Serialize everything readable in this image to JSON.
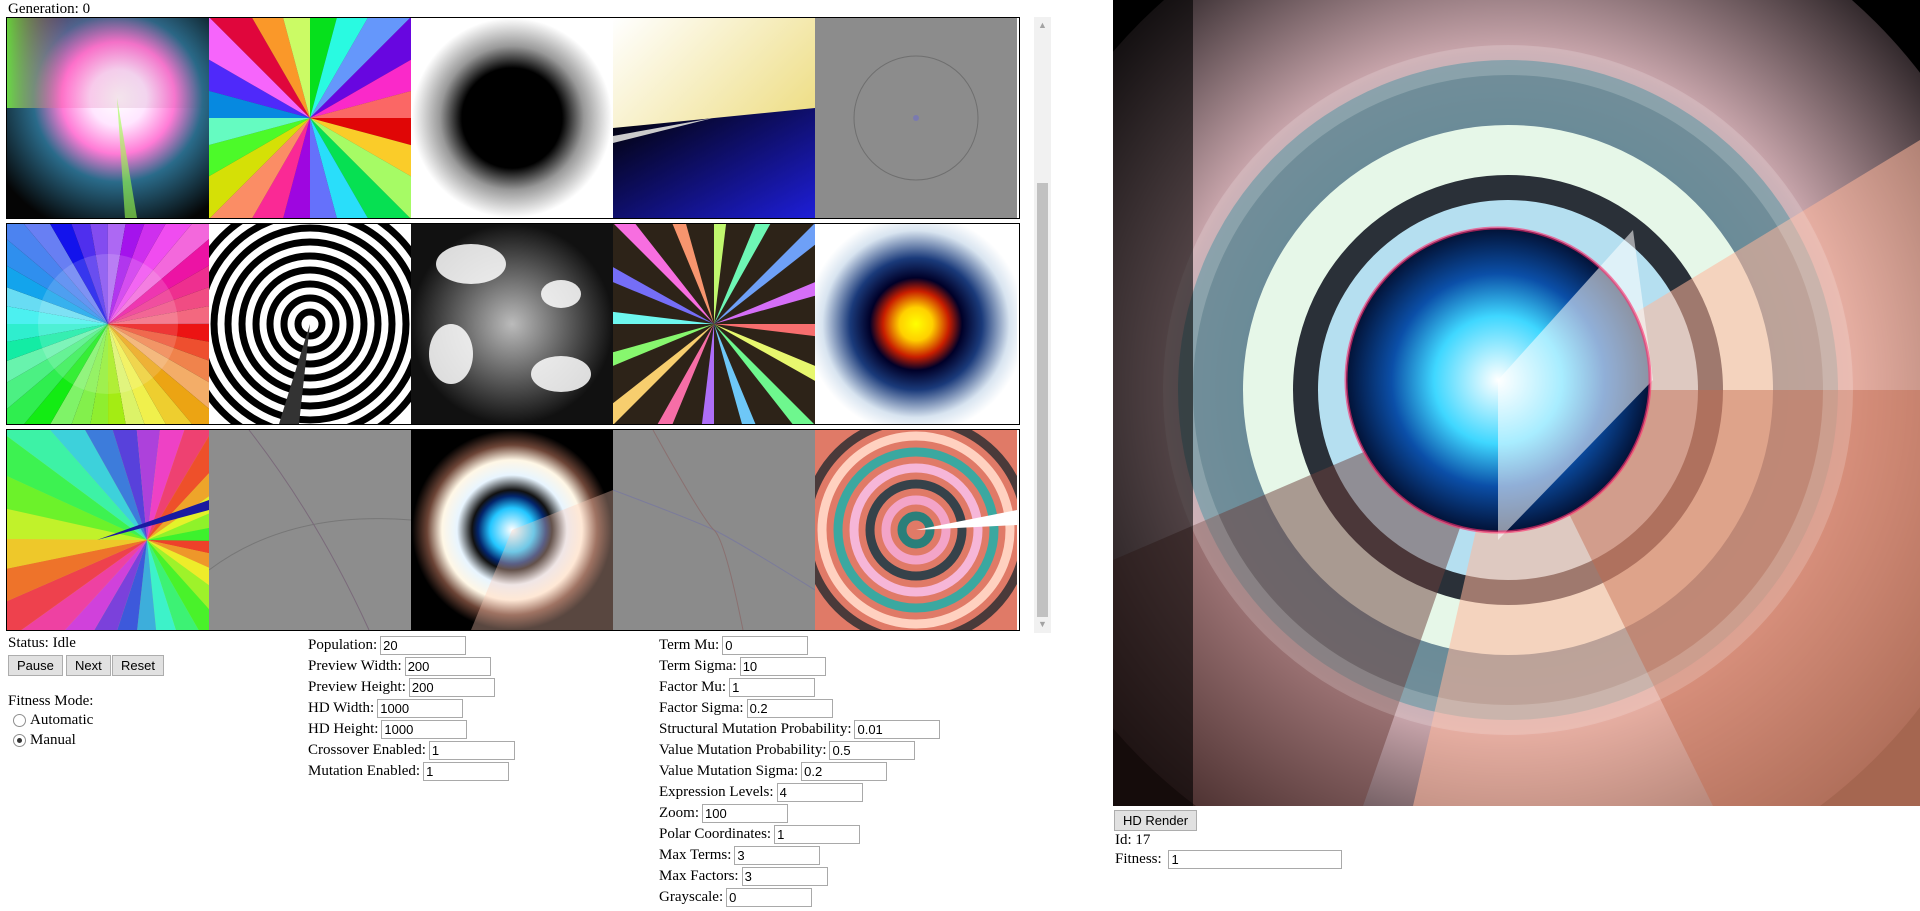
{
  "generation": {
    "label": "Generation:",
    "value": "0"
  },
  "status": {
    "label": "Status:",
    "value": "Idle"
  },
  "controls": {
    "pause": "Pause",
    "next": "Next",
    "reset": "Reset"
  },
  "fitness_mode": {
    "label": "Fitness Mode:",
    "options": [
      "Automatic",
      "Manual"
    ],
    "selected": "Manual"
  },
  "params_col1": [
    {
      "label": "Population:",
      "value": "20"
    },
    {
      "label": "Preview Width:",
      "value": "200"
    },
    {
      "label": "Preview Height:",
      "value": "200"
    },
    {
      "label": "HD Width:",
      "value": "1000"
    },
    {
      "label": "HD Height:",
      "value": "1000"
    },
    {
      "label": "Crossover Enabled:",
      "value": "1"
    },
    {
      "label": "Mutation Enabled:",
      "value": "1"
    }
  ],
  "params_col2": [
    {
      "label": "Term Mu:",
      "value": "0"
    },
    {
      "label": "Term Sigma:",
      "value": "10"
    },
    {
      "label": "Factor Mu:",
      "value": "1"
    },
    {
      "label": "Factor Sigma:",
      "value": "0.2"
    },
    {
      "label": "Structural Mutation Probability:",
      "value": "0.01"
    },
    {
      "label": "Value Mutation Probability:",
      "value": "0.5"
    },
    {
      "label": "Value Mutation Sigma:",
      "value": "0.2"
    },
    {
      "label": "Expression Levels:",
      "value": "4"
    },
    {
      "label": "Zoom:",
      "value": "100"
    },
    {
      "label": "Polar Coordinates:",
      "value": "1"
    },
    {
      "label": "Max Terms:",
      "value": "3"
    },
    {
      "label": "Max Factors:",
      "value": "3"
    },
    {
      "label": "Grayscale:",
      "value": "0"
    }
  ],
  "hd_panel": {
    "render_button": "HD Render",
    "id_label": "Id:",
    "id_value": "17",
    "fitness_label": "Fitness:",
    "fitness_value": "1"
  },
  "thumbnail_styles": [
    "rainbow-glow",
    "rainbow-rays",
    "dark-ring",
    "yellow-blue-split",
    "gray-noise",
    "color-wheel",
    "bw-interference",
    "bw-swirl",
    "rainbow-star",
    "fire-dot",
    "rainbow-spiral",
    "gray-swirl",
    "eye-small",
    "gray-lines",
    "pink-rings"
  ],
  "colors": {
    "scroll_track": "#f1f1f1",
    "scroll_thumb": "#c1c1c1",
    "button_bg": "#e1e1e1"
  }
}
